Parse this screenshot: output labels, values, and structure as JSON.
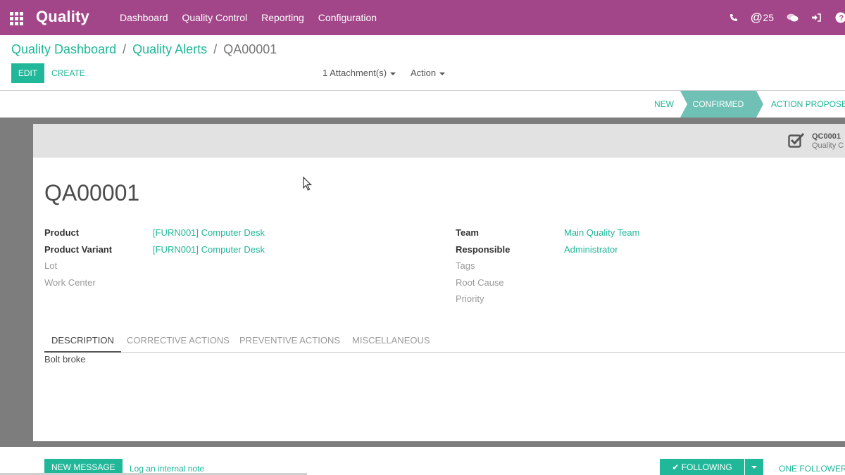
{
  "navbar": {
    "app_name": "Quality",
    "menu": [
      "Dashboard",
      "Quality Control",
      "Reporting",
      "Configuration"
    ],
    "mentions_count": "25",
    "icons": [
      "apps-icon",
      "phone-icon",
      "mention-icon",
      "chat-icon",
      "sign-out-icon",
      "help-icon"
    ]
  },
  "breadcrumb": {
    "items": [
      "Quality Dashboard",
      "Quality Alerts"
    ],
    "current": "QA00001",
    "separator": "/"
  },
  "buttons": {
    "edit": "EDIT",
    "create": "CREATE"
  },
  "sidebar": {
    "attachments": "1 Attachment(s)",
    "action": "Action"
  },
  "statusbar": {
    "stages": [
      "NEW",
      "CONFIRMED",
      "ACTION PROPOSED"
    ],
    "active": "CONFIRMED"
  },
  "smart_button": {
    "title": "QC0001",
    "subtitle": "Quality C"
  },
  "record": {
    "name": "QA00001",
    "left_fields": [
      {
        "label": "Product",
        "value": "[FURN001] Computer Desk"
      },
      {
        "label": "Product Variant",
        "value": "[FURN001] Computer Desk"
      },
      {
        "label": "Lot",
        "value": ""
      },
      {
        "label": "Work Center",
        "value": ""
      }
    ],
    "right_fields": [
      {
        "label": "Team",
        "value": "Main Quality Team"
      },
      {
        "label": "Responsible",
        "value": "Administrator"
      },
      {
        "label": "Tags",
        "value": ""
      },
      {
        "label": "Root Cause",
        "value": ""
      },
      {
        "label": "Priority",
        "value": ""
      }
    ]
  },
  "tabs": [
    "DESCRIPTION",
    "CORRECTIVE ACTIONS",
    "PREVENTIVE ACTIONS",
    "MISCELLANEOUS"
  ],
  "active_tab": "DESCRIPTION",
  "description": "Bolt broke",
  "chatter": {
    "new_message": "NEW MESSAGE",
    "log_note": "Log an internal note",
    "following": "FOLLOWING",
    "followers": "ONE FOLLOWER"
  },
  "colors": {
    "navbar": "#a24689",
    "accent": "#21b799",
    "stage_active": "#6fc1b5"
  }
}
